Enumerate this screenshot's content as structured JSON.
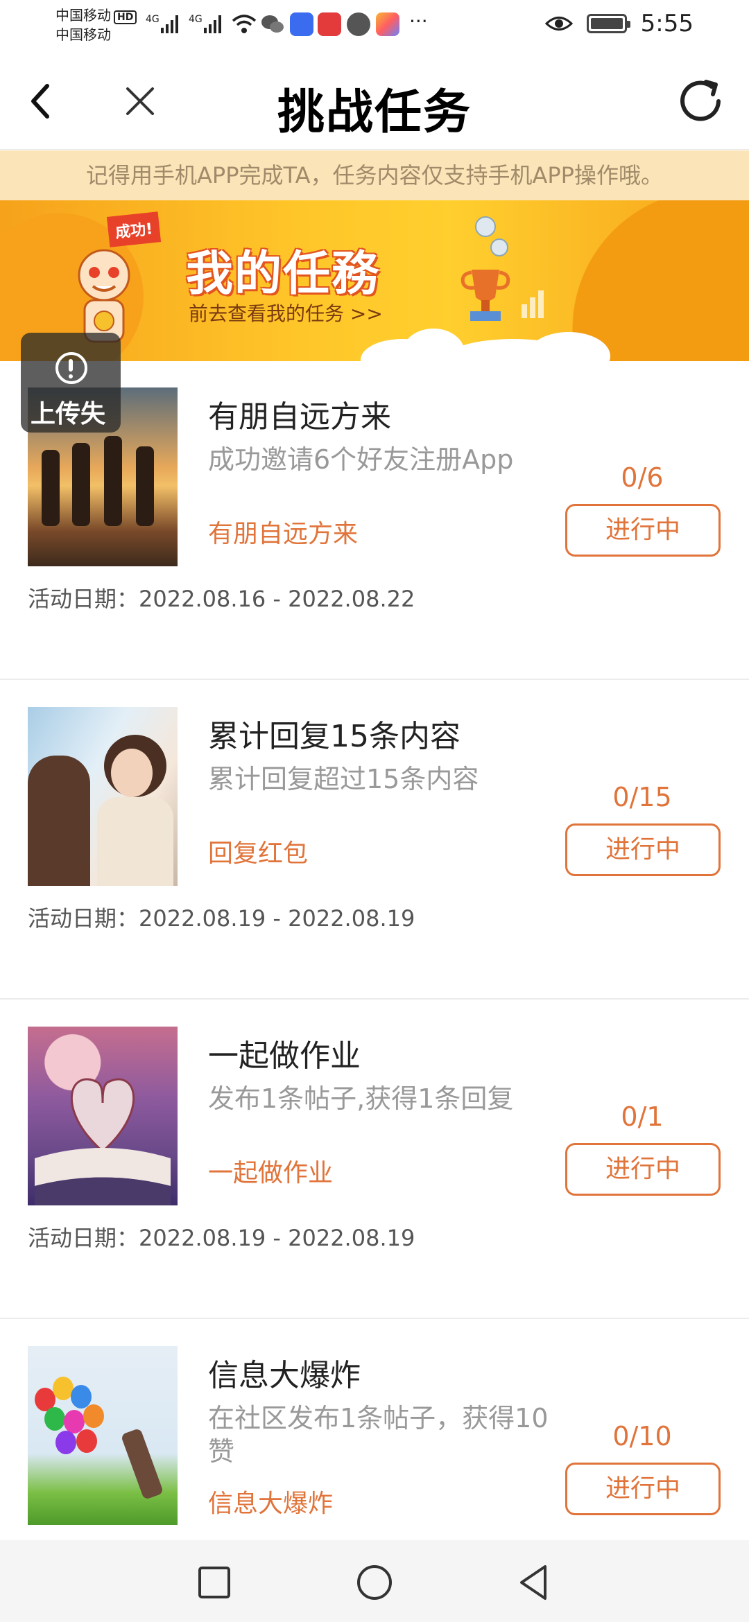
{
  "status_bar": {
    "carrier1": "中国移动",
    "carrier1_badge": "HD",
    "carrier2": "中国移动",
    "net1": "4G",
    "net2": "4G",
    "more": "···",
    "time": "5:55"
  },
  "header": {
    "title": "挑战任务"
  },
  "notice": "记得用手机APP完成TA，任务内容仅支持手机APP操作哦。",
  "banner": {
    "flag": "成功!",
    "title": "我的任務",
    "subtitle": "前去查看我的任务 >>"
  },
  "upload_overlay": {
    "label": "上传失"
  },
  "tasks": [
    {
      "title": "有朋自远方来",
      "desc": "成功邀请6个好友注册App",
      "link": "有朋自远方来",
      "progress": "0/6",
      "button": "进行中",
      "date": "活动日期：2022.08.16 - 2022.08.22",
      "image": "friends-beach-photo"
    },
    {
      "title": "累计回复15条内容",
      "desc": "累计回复超过15条内容",
      "link": "回复红包",
      "progress": "0/15",
      "button": "进行中",
      "date": "活动日期：2022.08.19 - 2022.08.19",
      "image": "two-girls-photo"
    },
    {
      "title": "一起做作业",
      "desc": "发布1条帖子,获得1条回复",
      "link": "一起做作业",
      "progress": "0/1",
      "button": "进行中",
      "date": "活动日期：2022.08.19 - 2022.08.19",
      "image": "book-heart-photo"
    },
    {
      "title": "信息大爆炸",
      "desc": "在社区发布1条帖子，获得10赞",
      "link": "信息大爆炸",
      "progress": "0/10",
      "button": "进行中",
      "date": "",
      "image": "balloons-photo"
    }
  ],
  "colors": {
    "accent": "#e0743a",
    "notice_bg": "#fbe5b8",
    "notice_text": "#a08a6a",
    "banner_orange": "#f6a21b",
    "banner_yellow": "#ffc629"
  },
  "icons": {
    "back": "chevron-left-icon",
    "close": "close-icon",
    "refresh": "refresh-icon",
    "nav_recent": "square-icon",
    "nav_home": "circle-icon",
    "nav_back": "triangle-back-icon"
  }
}
